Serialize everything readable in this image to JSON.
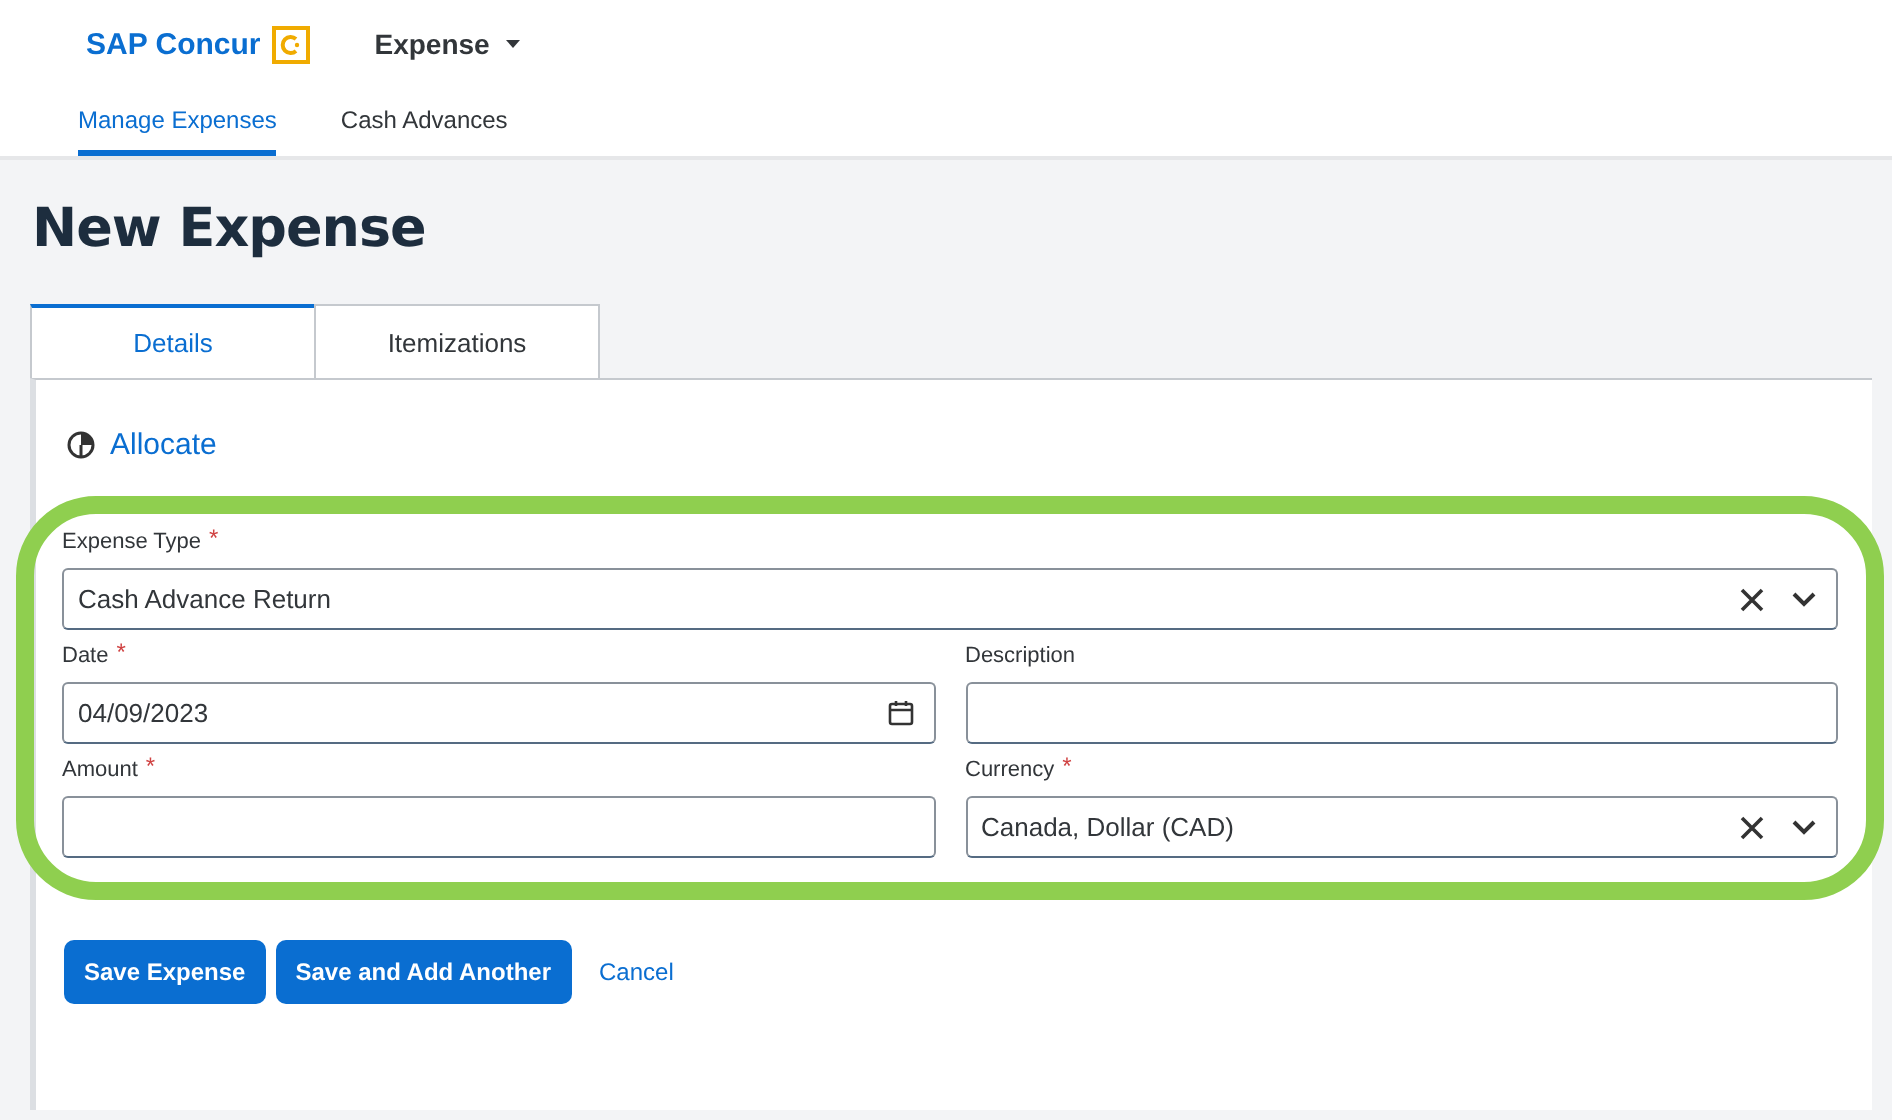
{
  "header": {
    "brand": "SAP Concur",
    "app_menu": "Expense"
  },
  "nav_tabs": [
    {
      "label": "Manage Expenses",
      "selected": true
    },
    {
      "label": "Cash Advances",
      "selected": false
    }
  ],
  "title": "New Expense",
  "tabs": [
    {
      "label": "Details",
      "selected": true
    },
    {
      "label": "Itemizations",
      "selected": false
    }
  ],
  "allocate": "Allocate",
  "fields": [
    {
      "kind": "select",
      "label": "Expense Type",
      "required_mark": "*",
      "value": "Cash Advance Return"
    },
    {
      "kind": "date",
      "label": "Date",
      "required_mark": "*",
      "value": "04/09/2023"
    },
    {
      "kind": "text",
      "label": "Description"
    },
    {
      "kind": "text",
      "label": "Amount",
      "required_mark": "*"
    },
    {
      "kind": "select",
      "label": "Currency",
      "required_mark": "*",
      "value": "Canada, Dollar (CAD)"
    }
  ],
  "buttons": [
    "Save Expense",
    "Save and Add Another"
  ],
  "cancel": "Cancel"
}
